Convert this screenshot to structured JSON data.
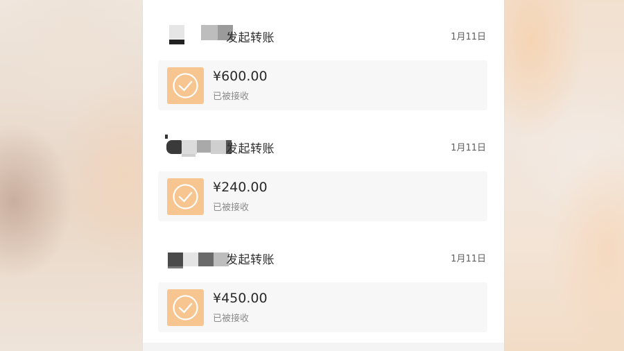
{
  "transfers": [
    {
      "action": "发起转账",
      "date": "1月11日",
      "amount": "¥600.00",
      "status": "已被接收"
    },
    {
      "action": "发起转账",
      "date": "1月11日",
      "amount": "¥240.00",
      "status": "已被接收"
    },
    {
      "action": "发起转账",
      "date": "1月11日",
      "amount": "¥450.00",
      "status": "已被接收"
    }
  ],
  "icons": {
    "status": "check-circle-icon"
  },
  "colors": {
    "accent": "#f7c58f",
    "card_bg": "#f7f7f7"
  }
}
